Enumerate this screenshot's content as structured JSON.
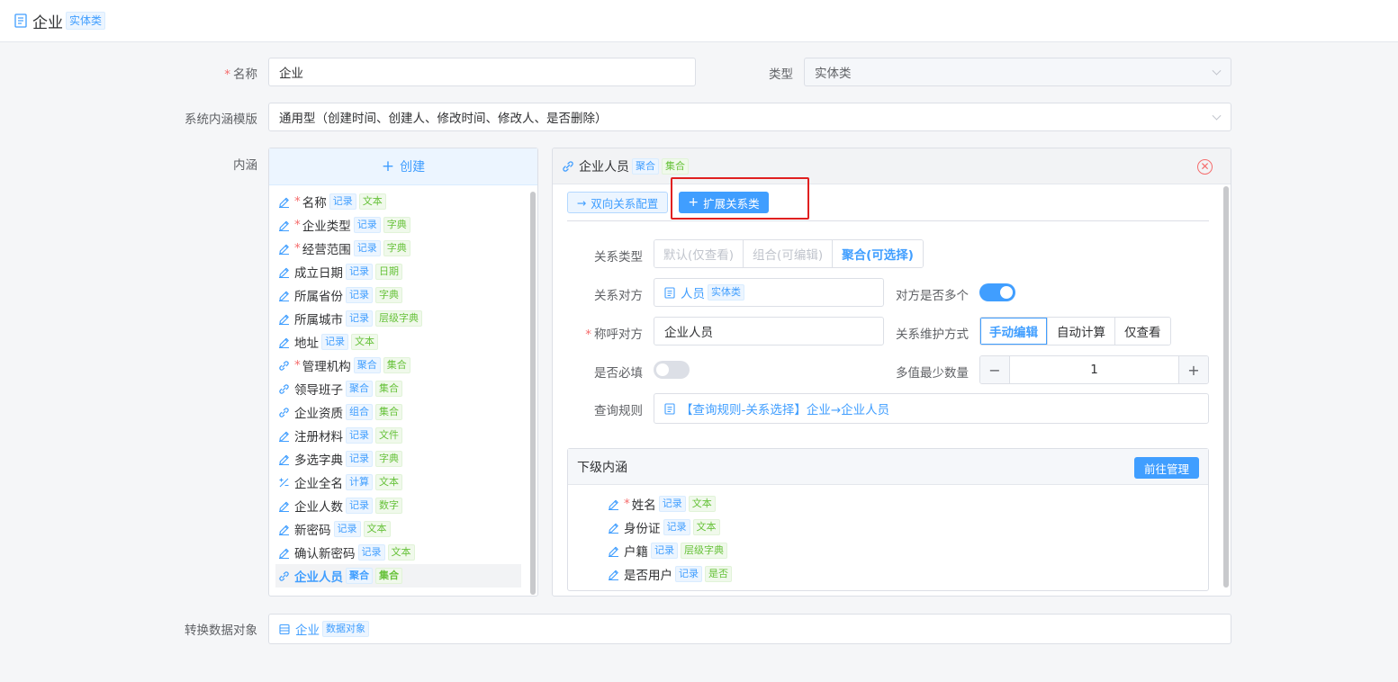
{
  "header": {
    "title": "企业",
    "tag": "实体类"
  },
  "form": {
    "name_label": "名称",
    "name_value": "企业",
    "type_label": "类型",
    "type_value": "实体类",
    "template_label": "系统内涵模版",
    "template_value": "通用型（创建时间、创建人、修改时间、修改人、是否删除）",
    "connotation_label": "内涵",
    "convert_label": "转换数据对象",
    "convert_value": "企业",
    "convert_tag": "数据对象"
  },
  "left_panel": {
    "create_label": "创建",
    "items": [
      {
        "name": "名称",
        "required": true,
        "icon": "pencil-icon",
        "tags": [
          "记录",
          "文本"
        ],
        "colors": [
          "blue",
          "green"
        ]
      },
      {
        "name": "企业类型",
        "required": true,
        "icon": "pencil-icon",
        "tags": [
          "记录",
          "字典"
        ],
        "colors": [
          "blue",
          "green"
        ]
      },
      {
        "name": "经营范围",
        "required": true,
        "icon": "pencil-icon",
        "tags": [
          "记录",
          "字典"
        ],
        "colors": [
          "blue",
          "green"
        ]
      },
      {
        "name": "成立日期",
        "required": false,
        "icon": "pencil-icon",
        "tags": [
          "记录",
          "日期"
        ],
        "colors": [
          "blue",
          "green"
        ]
      },
      {
        "name": "所属省份",
        "required": false,
        "icon": "pencil-icon",
        "tags": [
          "记录",
          "字典"
        ],
        "colors": [
          "blue",
          "green"
        ]
      },
      {
        "name": "所属城市",
        "required": false,
        "icon": "pencil-icon",
        "tags": [
          "记录",
          "层级字典"
        ],
        "colors": [
          "blue",
          "green"
        ]
      },
      {
        "name": "地址",
        "required": false,
        "icon": "pencil-icon",
        "tags": [
          "记录",
          "文本"
        ],
        "colors": [
          "blue",
          "green"
        ]
      },
      {
        "name": "管理机构",
        "required": true,
        "icon": "link-icon",
        "tags": [
          "聚合",
          "集合"
        ],
        "colors": [
          "blue",
          "green"
        ]
      },
      {
        "name": "领导班子",
        "required": false,
        "icon": "link-icon",
        "tags": [
          "聚合",
          "集合"
        ],
        "colors": [
          "blue",
          "green"
        ]
      },
      {
        "name": "企业资质",
        "required": false,
        "icon": "link-icon",
        "tags": [
          "组合",
          "集合"
        ],
        "colors": [
          "blue",
          "green"
        ]
      },
      {
        "name": "注册材料",
        "required": false,
        "icon": "pencil-icon",
        "tags": [
          "记录",
          "文件"
        ],
        "colors": [
          "blue",
          "green"
        ]
      },
      {
        "name": "多选字典",
        "required": false,
        "icon": "pencil-icon",
        "tags": [
          "记录",
          "字典"
        ],
        "colors": [
          "blue",
          "green"
        ]
      },
      {
        "name": "企业全名",
        "required": false,
        "icon": "calc-icon",
        "tags": [
          "计算",
          "文本"
        ],
        "colors": [
          "blue",
          "green"
        ]
      },
      {
        "name": "企业人数",
        "required": false,
        "icon": "pencil-icon",
        "tags": [
          "记录",
          "数字"
        ],
        "colors": [
          "blue",
          "green"
        ]
      },
      {
        "name": "新密码",
        "required": false,
        "icon": "pencil-icon",
        "tags": [
          "记录",
          "文本"
        ],
        "colors": [
          "blue",
          "green"
        ]
      },
      {
        "name": "确认新密码",
        "required": false,
        "icon": "pencil-icon",
        "tags": [
          "记录",
          "文本"
        ],
        "colors": [
          "blue",
          "green"
        ]
      },
      {
        "name": "企业人员",
        "required": false,
        "icon": "link-icon",
        "tags": [
          "聚合",
          "集合"
        ],
        "colors": [
          "blue",
          "green"
        ],
        "active": true
      }
    ]
  },
  "right_panel": {
    "title": "企业人员",
    "tags": [
      "聚合",
      "集合"
    ],
    "bidirectional_btn": "双向关系配置",
    "extend_btn": "扩展关系类",
    "relation_type_label": "关系类型",
    "relation_types": [
      "默认(仅查看)",
      "组合(可编辑)",
      "聚合(可选择)"
    ],
    "relation_target_label": "关系对方",
    "relation_target_value": "人员",
    "relation_target_tag": "实体类",
    "multi_label": "对方是否多个",
    "multi_on": true,
    "alias_label": "称呼对方",
    "alias_value": "企业人员",
    "maintain_label": "关系维护方式",
    "maintain_options": [
      "手动编辑",
      "自动计算",
      "仅查看"
    ],
    "required_label": "是否必填",
    "required_on": false,
    "min_label": "多值最少数量",
    "min_value": "1",
    "min_minus": "−",
    "min_plus": "+",
    "query_label": "查询规则",
    "query_value": "【查询规则-关系选择】企业→企业人员",
    "sub": {
      "title": "下级内涵",
      "manage_btn": "前往管理",
      "items": [
        {
          "name": "姓名",
          "required": true,
          "tags": [
            "记录",
            "文本"
          ],
          "colors": [
            "blue",
            "green"
          ]
        },
        {
          "name": "身份证",
          "required": false,
          "tags": [
            "记录",
            "文本"
          ],
          "colors": [
            "blue",
            "green"
          ]
        },
        {
          "name": "户籍",
          "required": false,
          "tags": [
            "记录",
            "层级字典"
          ],
          "colors": [
            "blue",
            "green"
          ]
        },
        {
          "name": "是否用户",
          "required": false,
          "tags": [
            "记录",
            "是否"
          ],
          "colors": [
            "blue",
            "green"
          ]
        }
      ]
    }
  },
  "colors": {
    "primary": "#409eff",
    "danger": "#f56c6c",
    "success": "#67c23a"
  }
}
